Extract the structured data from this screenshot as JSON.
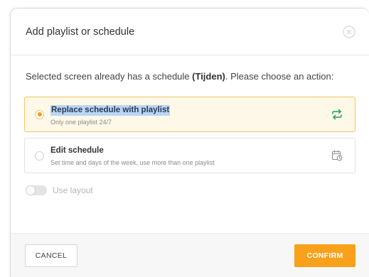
{
  "dialog": {
    "title": "Add playlist or schedule",
    "message_prefix": "Selected screen already has a schedule ",
    "schedule_name": "(Tijden)",
    "message_suffix": ". Please choose an action:"
  },
  "options": [
    {
      "title": "Replace schedule with playlist",
      "description": "Only one playlist 24/7",
      "icon": "repeat-icon",
      "selected": true
    },
    {
      "title": "Edit schedule",
      "description": "Set time and days of the week, use more than one playlist",
      "icon": "calendar-clock-icon",
      "selected": false
    }
  ],
  "toggle": {
    "label": "Use layout",
    "enabled": false
  },
  "footer": {
    "cancel_label": "CANCEL",
    "confirm_label": "CONFIRM"
  },
  "colors": {
    "accent": "#f9a11b",
    "icon_green": "#1e9e5a",
    "selected_bg": "#fdf8e7",
    "selected_border": "#f3c565"
  }
}
